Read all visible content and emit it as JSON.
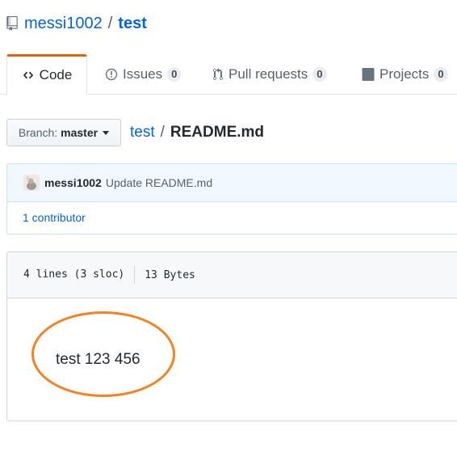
{
  "repo": {
    "owner": "messi1002",
    "separator": "/",
    "name": "test"
  },
  "tabs": [
    {
      "label": "Code",
      "icon": "code-icon",
      "selected": true
    },
    {
      "label": "Issues",
      "count": "0",
      "icon": "issue-icon"
    },
    {
      "label": "Pull requests",
      "count": "0",
      "icon": "pull-request-icon"
    },
    {
      "label": "Projects",
      "count": "0",
      "icon": "project-icon"
    }
  ],
  "branch": {
    "label": "Branch:",
    "value": "master"
  },
  "breadcrumb": {
    "repo": "test",
    "separator": "/",
    "file": "README.md"
  },
  "commit": {
    "author": "messi1002",
    "message": "Update README.md"
  },
  "contributors": "1 contributor",
  "file_info": {
    "lines": "4 lines (3 sloc)",
    "size": "13 Bytes"
  },
  "content": "test 123 456",
  "colors": {
    "link": "#0366d6",
    "tab_accent": "#e36209",
    "highlight": "#f5821f"
  }
}
